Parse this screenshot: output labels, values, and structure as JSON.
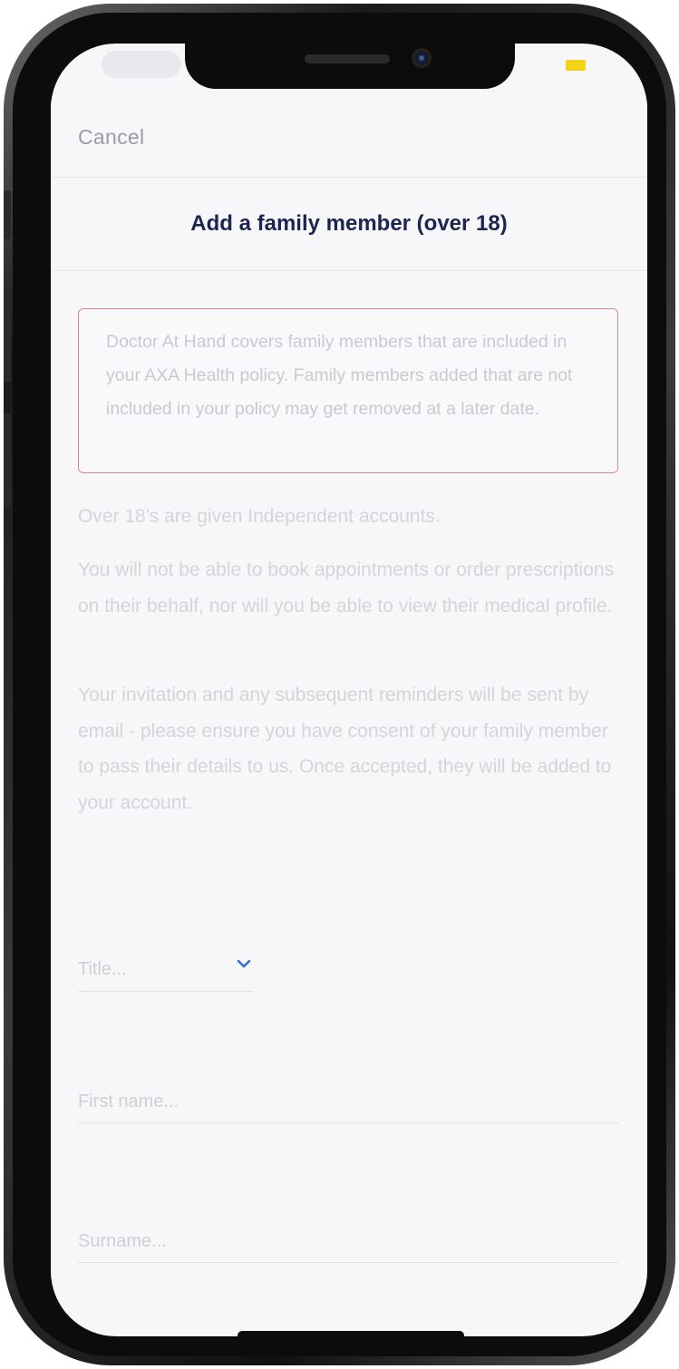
{
  "header": {
    "cancel_label": "Cancel",
    "title": "Add a family member (over 18)"
  },
  "notice": {
    "text": "Doctor At Hand covers family members that are included in your AXA Health policy. Family members added that are not included in your policy may get removed at a later date."
  },
  "info": [
    "Over 18's are given Independent accounts.",
    "You will not be able to book appointments or order prescriptions on their behalf, nor will you be able to view their medical profile.",
    "Your invitation and any subsequent reminders will be sent by email - please ensure you have consent of your family member to pass their details to us. Once accepted, they will be added to your account."
  ],
  "form": {
    "title_placeholder": "Title...",
    "first_name_placeholder": "First name...",
    "surname_placeholder": "Surname..."
  },
  "colors": {
    "title": "#1d2452",
    "notice_border": "#e2848a",
    "accent": "#2f6fd6",
    "battery": "#f4d21a"
  },
  "icons": {
    "dropdown": "chevron-down-icon"
  }
}
